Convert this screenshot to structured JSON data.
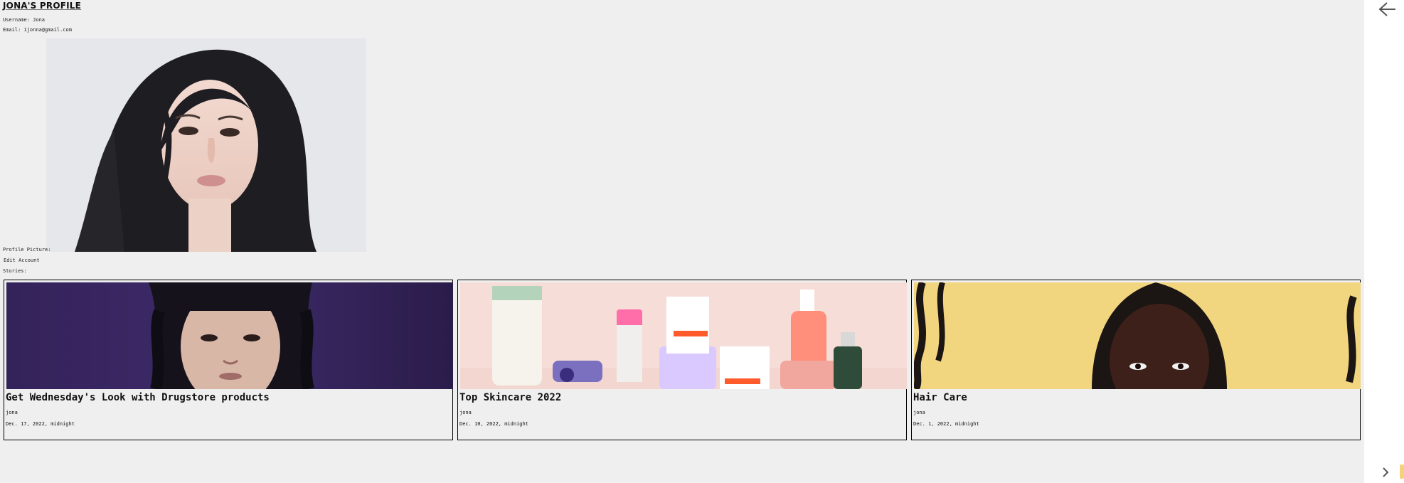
{
  "profile": {
    "title": "JONA'S PROFILE",
    "username_line": "Username: Jona",
    "email_line": "Email: 1jonna@gmail.com",
    "profile_picture_label": "Profile Picture:",
    "edit_account_label": "Edit Account",
    "stories_label": "Stories:"
  },
  "stories": [
    {
      "title": "Get Wednesday's Look with Drugstore products",
      "author": "jona",
      "date": "Dec. 17, 2022, midnight"
    },
    {
      "title": "Top Skincare 2022",
      "author": "jona",
      "date": "Dec. 10, 2022, midnight"
    },
    {
      "title": "Hair Care",
      "author": "jona",
      "date": "Dec. 1, 2022, midnight"
    }
  ],
  "icons": {
    "back": "arrow-left-icon",
    "next": "chevron-right-icon"
  }
}
